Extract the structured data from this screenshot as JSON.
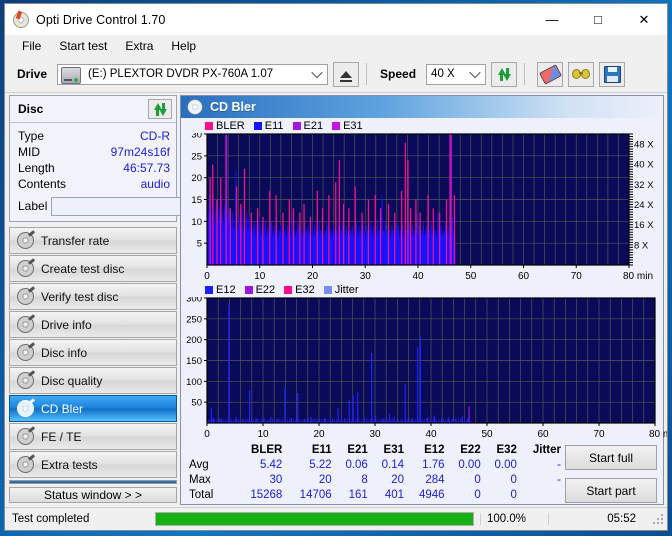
{
  "window": {
    "title": "Opti Drive Control 1.70",
    "app_icon": "cd-disc-icon",
    "minimize": "—",
    "maximize": "□",
    "close": "✕"
  },
  "menubar": {
    "items": [
      "File",
      "Start test",
      "Extra",
      "Help"
    ]
  },
  "toolbar": {
    "drive_label": "Drive",
    "drive_value": "(E:)   PLEXTOR DVDR   PX-760A 1.07",
    "eject_title": "eject-button",
    "speed_label": "Speed",
    "speed_value": "40 X",
    "refresh_title": "refresh-button",
    "erase_title": "erase-button",
    "specs_title": "settings-button",
    "save_title": "save-button"
  },
  "disc": {
    "header": "Disc",
    "refresh_title": "refresh-disc-button",
    "rows": [
      {
        "key": "Type",
        "value": "CD-R"
      },
      {
        "key": "MID",
        "value": "97m24s16f"
      },
      {
        "key": "Length",
        "value": "46:57.73"
      },
      {
        "key": "Contents",
        "value": "audio"
      }
    ],
    "label_key": "Label",
    "label_value": "",
    "label_placeholder": ""
  },
  "tests": {
    "items": [
      {
        "label": "Transfer rate",
        "selected": false
      },
      {
        "label": "Create test disc",
        "selected": false
      },
      {
        "label": "Verify test disc",
        "selected": false
      },
      {
        "label": "Drive info",
        "selected": false
      },
      {
        "label": "Disc info",
        "selected": false
      },
      {
        "label": "Disc quality",
        "selected": false
      },
      {
        "label": "CD Bler",
        "selected": true
      },
      {
        "label": "FE / TE",
        "selected": false
      },
      {
        "label": "Extra tests",
        "selected": false
      }
    ],
    "status_window_button": "Status window > >"
  },
  "panel": {
    "title": "CD Bler",
    "icon": "cd-disc-icon"
  },
  "chart_data": [
    {
      "type": "area",
      "name": "cd-bler-top-chart",
      "title": "CD Bler",
      "xlabel": "min",
      "ylabel": "",
      "xlim": [
        0,
        80
      ],
      "ylim": [
        0,
        30
      ],
      "xticks": [
        0,
        10,
        20,
        30,
        40,
        50,
        60,
        70,
        80
      ],
      "xticklabels": [
        "0",
        "10",
        "20",
        "30",
        "40",
        "50",
        "60",
        "70",
        "80 min"
      ],
      "yticks": [
        5,
        10,
        15,
        20,
        25,
        30
      ],
      "yticklabels": [
        "5",
        "10",
        "15",
        "20",
        "25",
        "30"
      ],
      "y2label": "X",
      "y2ticks": [
        8,
        16,
        24,
        32,
        40,
        48
      ],
      "y2ticklabels": [
        "8 X",
        "16 X",
        "24 X",
        "32 X",
        "40 X",
        "48 X"
      ],
      "y2lim": [
        0,
        52
      ],
      "grid": true,
      "plot_bg": "#0a0a5a",
      "data_end_min": 47,
      "legend": [
        {
          "label": "BLER",
          "color": "#ff0c8e"
        },
        {
          "label": "E11",
          "color": "#1414ff"
        },
        {
          "label": "E21",
          "color": "#a414e8"
        },
        {
          "label": "E31",
          "color": "#c414e8"
        }
      ],
      "series": [
        {
          "name": "E11",
          "color": "#1414ff",
          "base_level": 5.0,
          "values": [
            14,
            9,
            12,
            16,
            11,
            8,
            13,
            20,
            10,
            9,
            12,
            15,
            8,
            11,
            7,
            13,
            9,
            16,
            12,
            8,
            10,
            14,
            9,
            7,
            11,
            8,
            13,
            10,
            6,
            9,
            12,
            8,
            7,
            10,
            22,
            9,
            6,
            8,
            11,
            7,
            9,
            13,
            8,
            6,
            10,
            7,
            9,
            12,
            6,
            8,
            11,
            7,
            5,
            9,
            6,
            8,
            10,
            7,
            6,
            9,
            5,
            8,
            11,
            6,
            7,
            9,
            6,
            5,
            8,
            10,
            6,
            7,
            9,
            5,
            8,
            6,
            10,
            7,
            5,
            9,
            6,
            8,
            11,
            7,
            5,
            8,
            6,
            9,
            7,
            5,
            10,
            6,
            8,
            5,
            7,
            9,
            6,
            8,
            5,
            7,
            11,
            6,
            9,
            7,
            5,
            8,
            6,
            10,
            7,
            5,
            9,
            6,
            8,
            5,
            7,
            10,
            6,
            8,
            5,
            9,
            7,
            6,
            8,
            5,
            10,
            7,
            6,
            9,
            5,
            8,
            6,
            7,
            10,
            5,
            8,
            6,
            9,
            7,
            5,
            8,
            6,
            10,
            7,
            5,
            9,
            6,
            8,
            5,
            7,
            9,
            6,
            8,
            11,
            5,
            7,
            9,
            6,
            8,
            5,
            10,
            7,
            6,
            8,
            5,
            9,
            7,
            6,
            10,
            5,
            8,
            6,
            9,
            7,
            5,
            8,
            6,
            10,
            7,
            5,
            9,
            6,
            8,
            5,
            7,
            10,
            6,
            8,
            5,
            9,
            7,
            6,
            8,
            5,
            10,
            7,
            6,
            9,
            5,
            8,
            6,
            7,
            10,
            5,
            8,
            6,
            9,
            16,
            5,
            8,
            6,
            10,
            7,
            5,
            9,
            6,
            8,
            5,
            7,
            9,
            6,
            8,
            5,
            7,
            10,
            6,
            9,
            7,
            5,
            8,
            6,
            10,
            7,
            5,
            9,
            6,
            8,
            5,
            7,
            10,
            6,
            8,
            5,
            9,
            7,
            6,
            8,
            5,
            12,
            7,
            6,
            9,
            5,
            8,
            6,
            7,
            10,
            5,
            8,
            6,
            9,
            7,
            5,
            8,
            6,
            10,
            7,
            5,
            9,
            6,
            8,
            5,
            7,
            12,
            6,
            8,
            5,
            9,
            7,
            6,
            8,
            5,
            10,
            7,
            6,
            9,
            5,
            8,
            6,
            7,
            11,
            5,
            8,
            6
          ]
        },
        {
          "name": "BLER",
          "color": "#ff0c8e",
          "spikes": [
            [
              0.6,
              20
            ],
            [
              1.1,
              23
            ],
            [
              1.9,
              15
            ],
            [
              2.6,
              20
            ],
            [
              3.6,
              30
            ],
            [
              4.4,
              13
            ],
            [
              5.6,
              18
            ],
            [
              6.4,
              14
            ],
            [
              7.1,
              22
            ],
            [
              8.4,
              12
            ],
            [
              9.6,
              13
            ],
            [
              10.6,
              11
            ],
            [
              11.9,
              17
            ],
            [
              13.1,
              16
            ],
            [
              14.4,
              12
            ],
            [
              15.6,
              15
            ],
            [
              16.4,
              13
            ],
            [
              17.6,
              12
            ],
            [
              18.4,
              14
            ],
            [
              19.6,
              11
            ],
            [
              20.9,
              17
            ],
            [
              21.9,
              13
            ],
            [
              23.1,
              16
            ],
            [
              24.4,
              19
            ],
            [
              25.1,
              24
            ],
            [
              25.9,
              14
            ],
            [
              26.9,
              13
            ],
            [
              28.1,
              18
            ],
            [
              29.4,
              12
            ],
            [
              30.6,
              15
            ],
            [
              31.9,
              16
            ],
            [
              32.9,
              13
            ],
            [
              34.4,
              14
            ],
            [
              35.6,
              12
            ],
            [
              36.9,
              17
            ],
            [
              37.6,
              28
            ],
            [
              38.1,
              24
            ],
            [
              38.6,
              13
            ],
            [
              39.6,
              15
            ],
            [
              40.4,
              12
            ],
            [
              41.9,
              16
            ],
            [
              42.9,
              13
            ],
            [
              44.1,
              12
            ],
            [
              45.4,
              15
            ],
            [
              46.1,
              30
            ],
            [
              46.9,
              16
            ]
          ]
        },
        {
          "name": "E21",
          "color": "#a414e8",
          "spikes": [
            [
              3.7,
              30
            ],
            [
              46.3,
              30
            ]
          ]
        },
        {
          "name": "E31",
          "color": "#c414e8",
          "spikes": []
        }
      ]
    },
    {
      "type": "line",
      "name": "cd-bler-bottom-chart",
      "xlabel": "min",
      "ylabel": "",
      "xlim": [
        0,
        80
      ],
      "ylim": [
        0,
        300
      ],
      "xticks": [
        0,
        10,
        20,
        30,
        40,
        50,
        60,
        70,
        80
      ],
      "xticklabels": [
        "0",
        "10",
        "20",
        "30",
        "40",
        "50",
        "60",
        "70",
        "80 min"
      ],
      "yticks": [
        50,
        100,
        150,
        200,
        250,
        300
      ],
      "yticklabels": [
        "50",
        "100",
        "150",
        "200",
        "250",
        "300"
      ],
      "grid": true,
      "plot_bg": "#0a0a5a",
      "data_end_min": 47,
      "legend": [
        {
          "label": "E12",
          "color": "#2020ff"
        },
        {
          "label": "E22",
          "color": "#9a14e8"
        },
        {
          "label": "E32",
          "color": "#ff0c8e"
        },
        {
          "label": "Jitter",
          "color": "#7b8cf0"
        }
      ],
      "series": [
        {
          "name": "E12",
          "color": "#2020ff",
          "spikes": [
            [
              0.8,
              35
            ],
            [
              1.2,
              12
            ],
            [
              2.4,
              10
            ],
            [
              3.9,
              284
            ],
            [
              5.2,
              14
            ],
            [
              6.4,
              10
            ],
            [
              7.6,
              78
            ],
            [
              8.9,
              12
            ],
            [
              10.1,
              10
            ],
            [
              11.4,
              14
            ],
            [
              12.6,
              10
            ],
            [
              13.9,
              86
            ],
            [
              15.1,
              12
            ],
            [
              16.2,
              72
            ],
            [
              17.4,
              10
            ],
            [
              18.6,
              14
            ],
            [
              19.9,
              10
            ],
            [
              21.1,
              12
            ],
            [
              22.4,
              10
            ],
            [
              23.4,
              36
            ],
            [
              24.6,
              12
            ],
            [
              25.4,
              56
            ],
            [
              26.1,
              66
            ],
            [
              26.9,
              73
            ],
            [
              28.1,
              12
            ],
            [
              29.4,
              168
            ],
            [
              30.1,
              18
            ],
            [
              31.4,
              10
            ],
            [
              32.6,
              22
            ],
            [
              33.4,
              14
            ],
            [
              35.4,
              94
            ],
            [
              36.6,
              12
            ],
            [
              37.6,
              182
            ],
            [
              38.1,
              208
            ],
            [
              39.4,
              14
            ],
            [
              40.6,
              18
            ],
            [
              41.9,
              12
            ],
            [
              43.1,
              14
            ],
            [
              44.4,
              10
            ],
            [
              45.6,
              16
            ],
            [
              46.6,
              12
            ]
          ]
        },
        {
          "name": "E22",
          "color": "#9a14e8",
          "spikes": [
            [
              46.8,
              40
            ]
          ]
        },
        {
          "name": "E32",
          "color": "#ff0c8e",
          "spikes": []
        },
        {
          "name": "Jitter",
          "color": "#7b8cf0",
          "spikes": []
        }
      ]
    }
  ],
  "stats": {
    "columns": [
      "BLER",
      "E11",
      "E21",
      "E31",
      "E12",
      "E22",
      "E32",
      "Jitter"
    ],
    "rows": [
      {
        "label": "Avg",
        "values": [
          "5.42",
          "5.22",
          "0.06",
          "0.14",
          "1.76",
          "0.00",
          "0.00",
          "-"
        ]
      },
      {
        "label": "Max",
        "values": [
          "30",
          "20",
          "8",
          "20",
          "284",
          "0",
          "0",
          "-"
        ]
      },
      {
        "label": "Total",
        "values": [
          "15268",
          "14706",
          "161",
          "401",
          "4946",
          "0",
          "0",
          ""
        ]
      }
    ]
  },
  "actions": {
    "start_full": "Start full",
    "start_part": "Start part"
  },
  "statusbar": {
    "text": "Test completed",
    "percent_label": "100.0%",
    "percent": 100,
    "time": "05:52"
  }
}
